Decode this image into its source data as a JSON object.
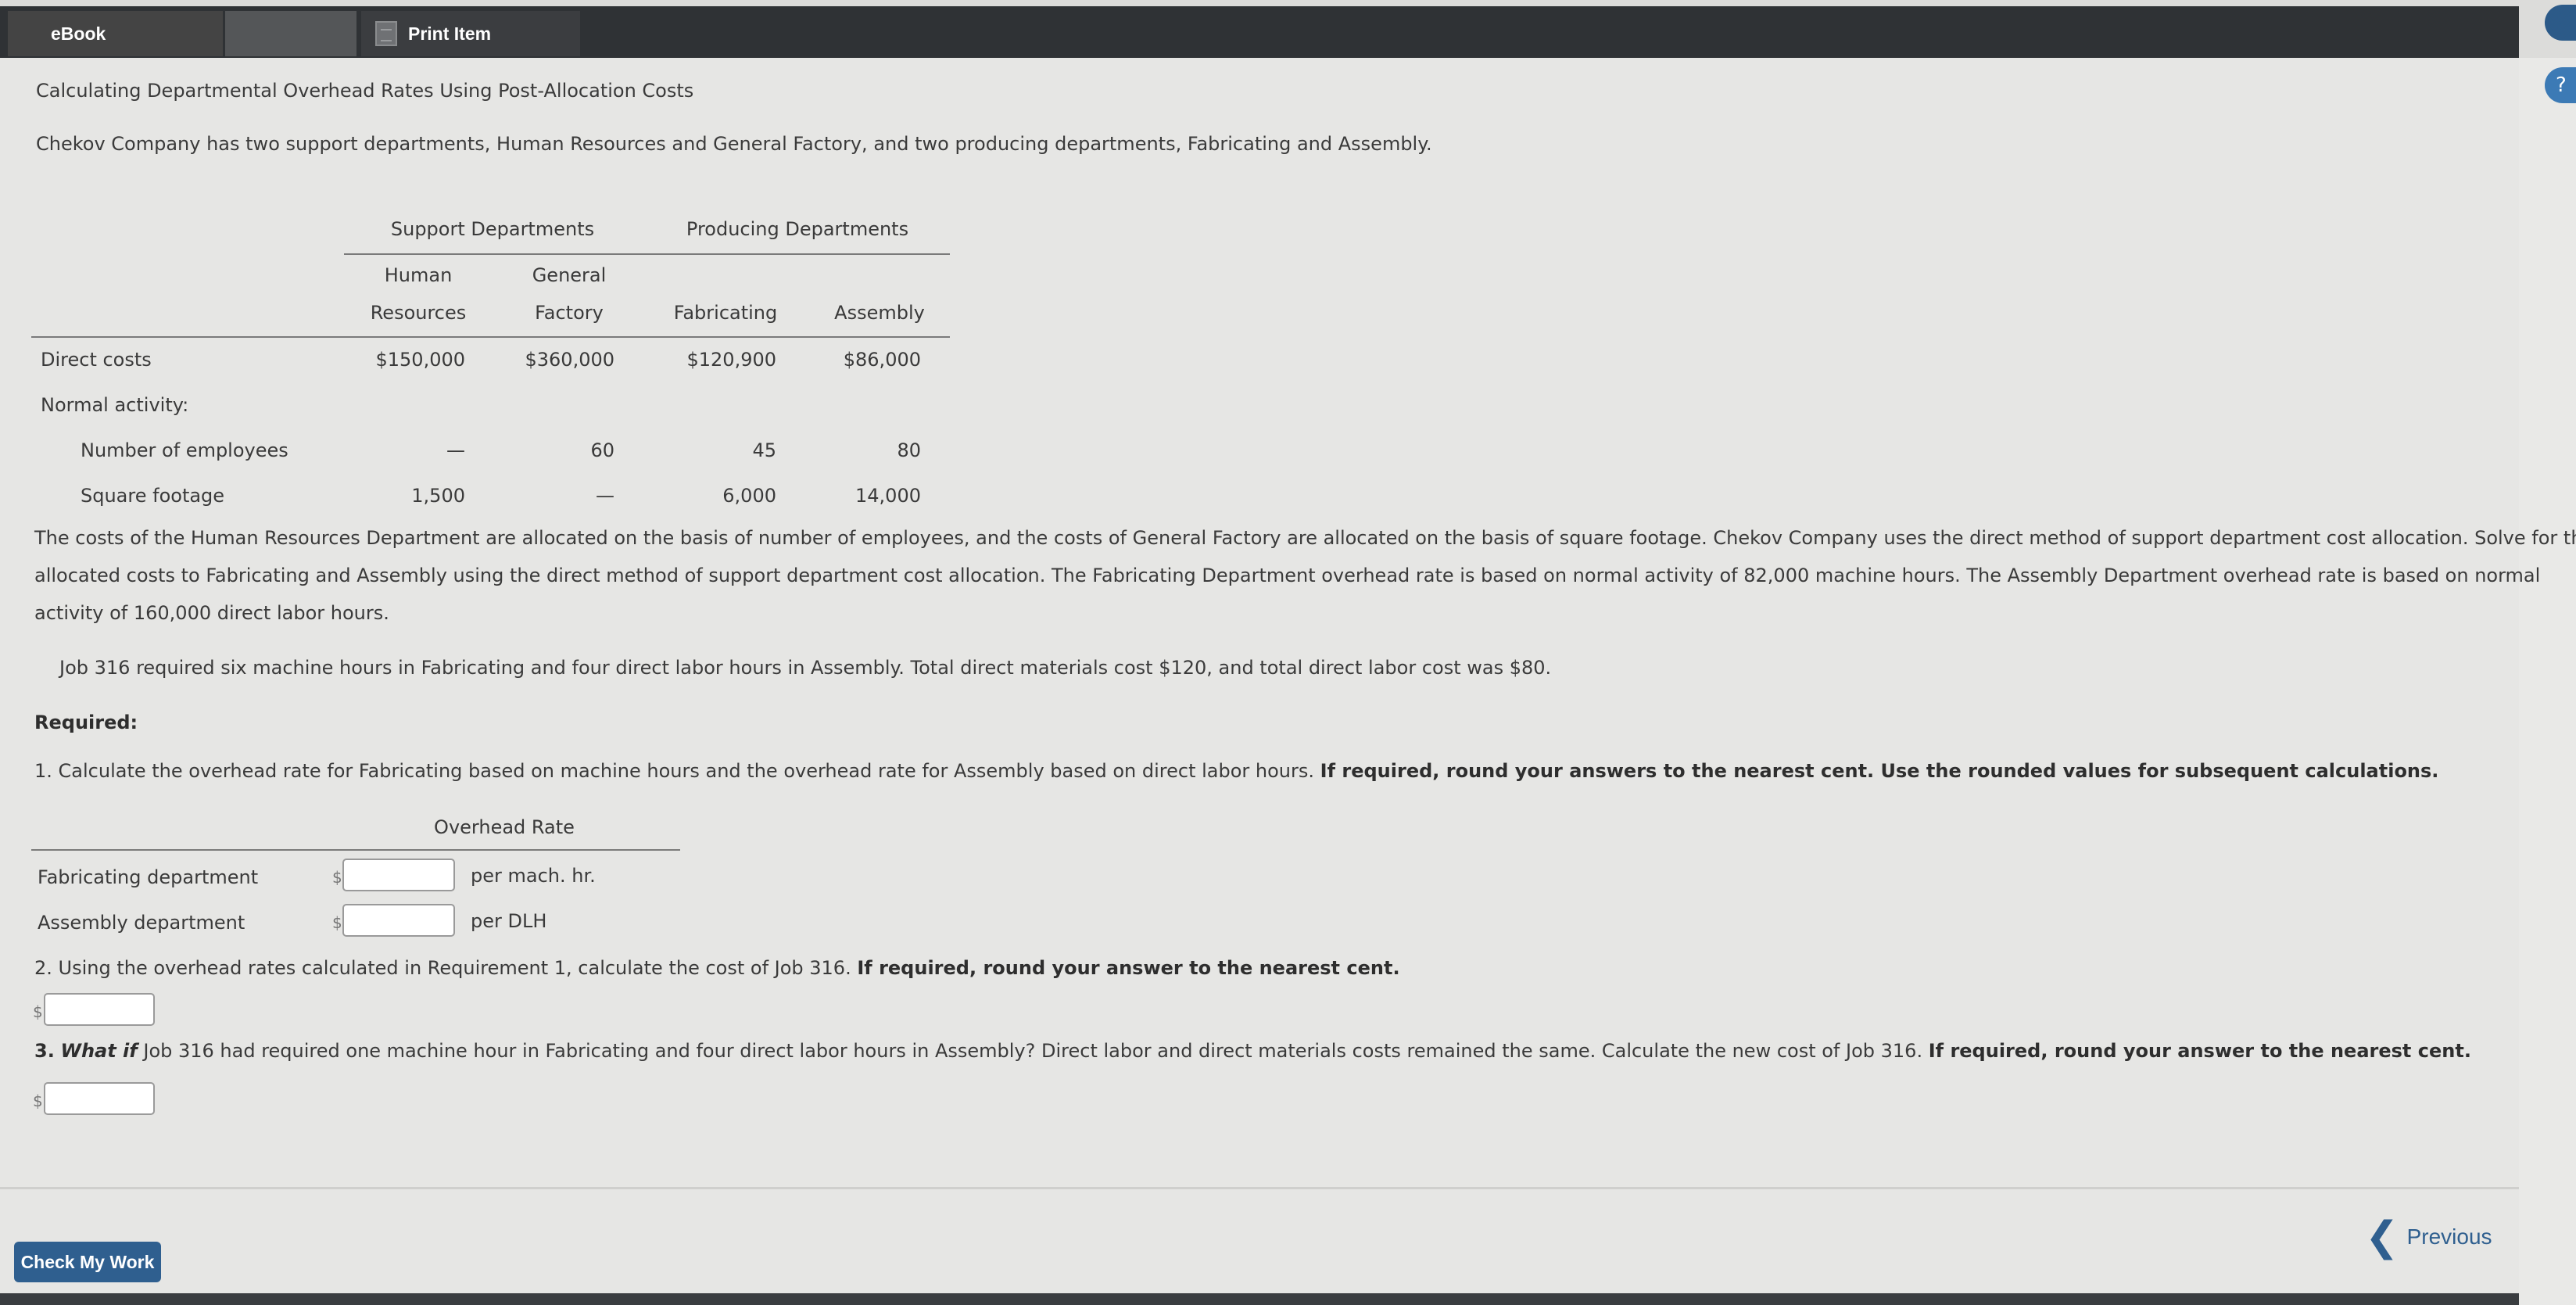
{
  "tabs": {
    "ebook": "eBook",
    "print": "Print Item"
  },
  "title": "Calculating Departmental Overhead Rates Using Post-Allocation Costs",
  "intro": "Chekov Company has two support departments, Human Resources and General Factory, and two producing departments, Fabricating and Assembly.",
  "table": {
    "group_support": "Support Departments",
    "group_producing": "Producing Departments",
    "col_hr_1": "Human",
    "col_hr_2": "Resources",
    "col_gf_1": "General",
    "col_gf_2": "Factory",
    "col_fab": "Fabricating",
    "col_asm": "Assembly",
    "rows": {
      "direct_costs": {
        "label": "Direct costs",
        "hr": "$150,000",
        "gf": "$360,000",
        "fab": "$120,900",
        "asm": "$86,000"
      },
      "normal_activity": {
        "label": "Normal activity:"
      },
      "employees": {
        "label": "Number of employees",
        "hr": "—",
        "gf": "60",
        "fab": "45",
        "asm": "80"
      },
      "sqft": {
        "label": "Square footage",
        "hr": "1,500",
        "gf": "—",
        "fab": "6,000",
        "asm": "14,000"
      }
    }
  },
  "para1_line1": "The costs of the Human Resources Department are allocated on the basis of number of employees, and the costs of General Factory are allocated on the basis of square footage. Chekov Company uses the direct method of support department cost allocation. Solve for the",
  "para1_line2": "allocated costs to Fabricating and Assembly using the direct method of support department cost allocation. The Fabricating Department overhead rate is based on normal activity of 82,000 machine hours. The Assembly Department overhead rate is based on normal",
  "para1_line3": "activity of 160,000 direct labor hours.",
  "para2": "Job 316 required six machine hours in Fabricating and four direct labor hours in Assembly. Total direct materials cost $120, and total direct labor cost was $80.",
  "required": "Required:",
  "q1_text": "1. Calculate the overhead rate for Fabricating based on machine hours and the overhead rate for Assembly based on direct labor hours.",
  "q1_bold": "If required, round your answers to the nearest cent. Use the rounded values for subsequent calculations.",
  "rate_table": {
    "header": "Overhead Rate",
    "fab_label": "Fabricating department",
    "fab_unit": "per mach. hr.",
    "asm_label": "Assembly department",
    "asm_unit": "per DLH",
    "currency": "$",
    "fab_value": "",
    "asm_value": ""
  },
  "q2_text": "2. Using the overhead rates calculated in Requirement 1, calculate the cost of Job 316.",
  "q2_bold": "If required, round your answer to the nearest cent.",
  "q2_currency": "$",
  "q2_value": "",
  "q3_num": "3.",
  "q3_whatif": "What if",
  "q3_text": "Job 316 had required one machine hour in Fabricating and four direct labor hours in Assembly? Direct labor and direct materials costs remained the same. Calculate the new cost of Job 316.",
  "q3_bold": "If required, round your answer to the nearest cent.",
  "q3_currency": "$",
  "q3_value": "",
  "buttons": {
    "check": "Check My Work",
    "previous": "Previous"
  },
  "side_icon": "?"
}
